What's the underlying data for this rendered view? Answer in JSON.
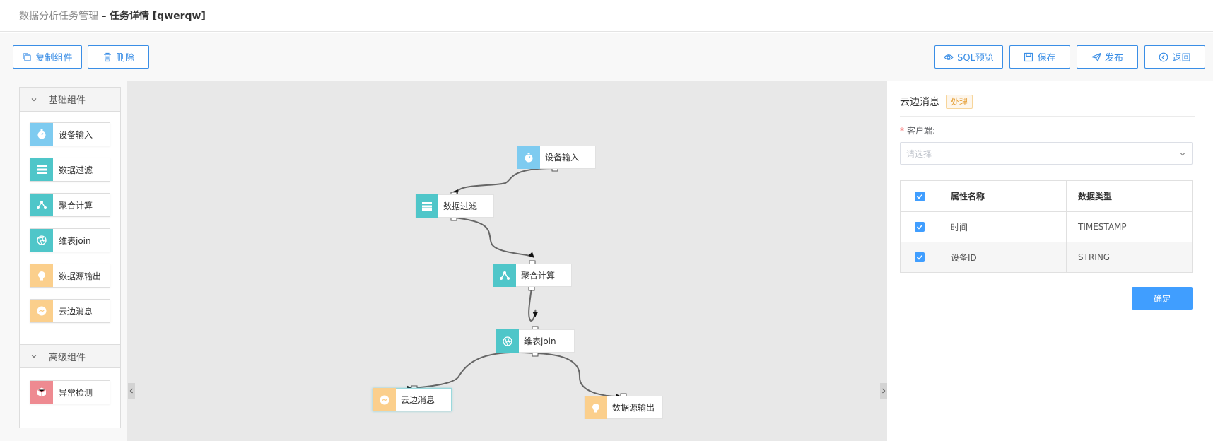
{
  "header": {
    "crumb_parent": "数据分析任务管理",
    "crumb_sep": "–",
    "crumb_current": "任务详情 [qwerqw]"
  },
  "toolbar": {
    "copy_label": "复制组件",
    "delete_label": "删除",
    "sql_preview_label": "SQL预览",
    "save_label": "保存",
    "publish_label": "发布",
    "back_label": "返回",
    "accent": "#3a8ee6"
  },
  "palette": {
    "basic_title": "基础组件",
    "advanced_title": "高级组件",
    "basic_items": [
      {
        "label": "设备输入",
        "icon": "stopwatch-icon",
        "color": "#7ecbf0"
      },
      {
        "label": "数据过滤",
        "icon": "table-icon",
        "color": "#4fc6c9"
      },
      {
        "label": "聚合计算",
        "icon": "share-icon",
        "color": "#4fc6c9"
      },
      {
        "label": "维表join",
        "icon": "aperture-icon",
        "color": "#4fc6c9"
      },
      {
        "label": "数据源输出",
        "icon": "bulb-icon",
        "color": "#fbcf8c"
      },
      {
        "label": "云边消息",
        "icon": "message-icon",
        "color": "#fbcf8c"
      }
    ],
    "advanced_items": [
      {
        "label": "异常检测",
        "icon": "cube-icon",
        "color": "#ee8a91"
      }
    ]
  },
  "canvas": {
    "nodes": [
      {
        "id": "device_input",
        "label": "设备输入",
        "icon": "stopwatch-icon",
        "color": "#7ecbf0"
      },
      {
        "id": "data_filter",
        "label": "数据过滤",
        "icon": "table-icon",
        "color": "#4fc6c9"
      },
      {
        "id": "aggregate",
        "label": "聚合计算",
        "icon": "share-icon",
        "color": "#4fc6c9"
      },
      {
        "id": "dim_join",
        "label": "维表join",
        "icon": "aperture-icon",
        "color": "#4fc6c9"
      },
      {
        "id": "cloud_msg",
        "label": "云边消息",
        "icon": "message-icon",
        "color": "#fbcf8c"
      },
      {
        "id": "ds_output",
        "label": "数据源输出",
        "icon": "bulb-icon",
        "color": "#fbcf8c"
      }
    ]
  },
  "panel": {
    "title": "云边消息",
    "tag": "处理",
    "client_label": "客户端:",
    "client_placeholder": "请选择",
    "table": {
      "col_name": "属性名称",
      "col_type": "数据类型",
      "rows": [
        {
          "name": "时间",
          "type": "TIMESTAMP",
          "checked": true
        },
        {
          "name": "设备ID",
          "type": "STRING",
          "checked": true
        }
      ]
    },
    "confirm_label": "确定"
  }
}
